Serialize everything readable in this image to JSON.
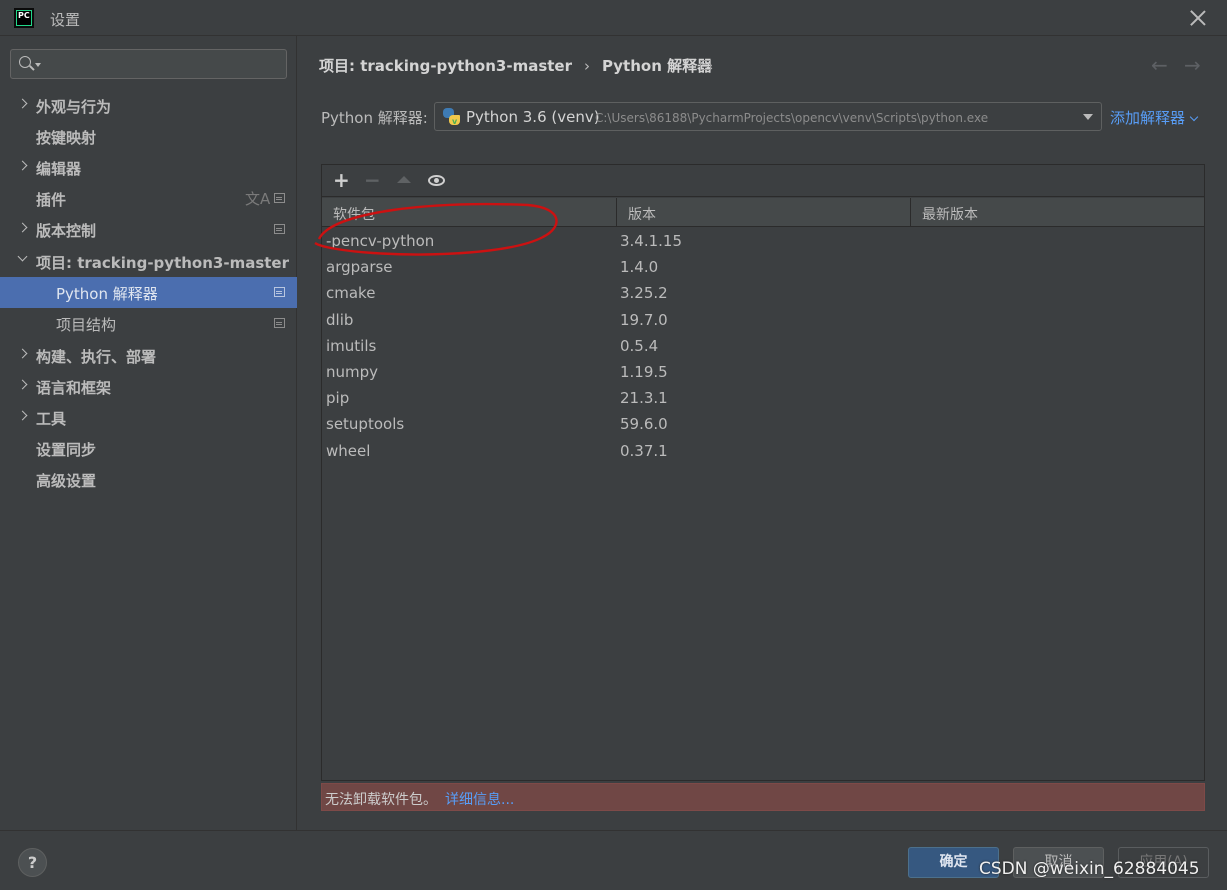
{
  "window": {
    "title": "设置"
  },
  "sidebar": {
    "search": {
      "placeholder": ""
    },
    "items": [
      {
        "label": "外观与行为"
      },
      {
        "label": "按键映射"
      },
      {
        "label": "编辑器"
      },
      {
        "label": "插件"
      },
      {
        "label": "版本控制"
      },
      {
        "label": "项目: tracking-python3-master"
      },
      {
        "label": "Python 解释器"
      },
      {
        "label": "项目结构"
      },
      {
        "label": "构建、执行、部署"
      },
      {
        "label": "语言和框架"
      },
      {
        "label": "工具"
      },
      {
        "label": "设置同步"
      },
      {
        "label": "高级设置"
      }
    ],
    "translate_glyph": "文A"
  },
  "breadcrumb": {
    "project": "项目: tracking-python3-master",
    "separator": "›",
    "page": "Python 解释器"
  },
  "nav": {
    "back": "←",
    "forward": "→"
  },
  "interpreter": {
    "label": "Python 解释器:",
    "name": "Python 3.6 (venv)",
    "path": "C:\\Users\\86188\\PycharmProjects\\opencv\\venv\\Scripts\\python.exe",
    "add_label": "添加解释器"
  },
  "toolbar": {
    "add": "+",
    "remove": "−"
  },
  "table": {
    "columns": [
      "软件包",
      "版本",
      "最新版本"
    ],
    "rows": [
      {
        "name": "-pencv-python",
        "version": "3.4.1.15",
        "latest": ""
      },
      {
        "name": "argparse",
        "version": "1.4.0",
        "latest": ""
      },
      {
        "name": "cmake",
        "version": "3.25.2",
        "latest": ""
      },
      {
        "name": "dlib",
        "version": "19.7.0",
        "latest": ""
      },
      {
        "name": "imutils",
        "version": "0.5.4",
        "latest": ""
      },
      {
        "name": "numpy",
        "version": "1.19.5",
        "latest": ""
      },
      {
        "name": "pip",
        "version": "21.3.1",
        "latest": ""
      },
      {
        "name": "setuptools",
        "version": "59.6.0",
        "latest": ""
      },
      {
        "name": "wheel",
        "version": "0.37.1",
        "latest": ""
      }
    ]
  },
  "error": {
    "message": "无法卸载软件包。",
    "link": "详细信息..."
  },
  "footer": {
    "help": "?",
    "ok": "确定",
    "cancel": "取消",
    "apply": "应用(A)"
  },
  "watermark": "CSDN @weixin_62884045",
  "colors": {
    "selection": "#4b6eaf",
    "link": "#589df6",
    "error_bg": "#704745",
    "annotation": "#cc1111"
  }
}
